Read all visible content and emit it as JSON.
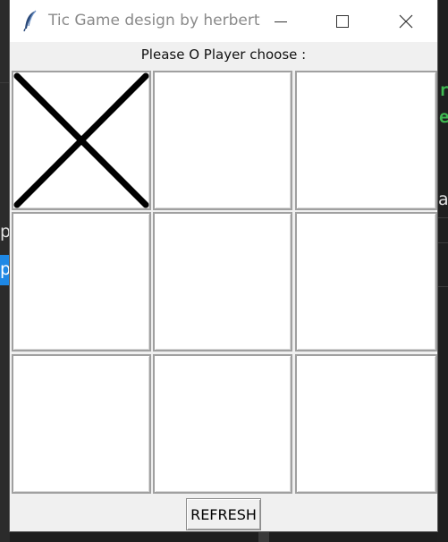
{
  "window": {
    "title": "Tic Game design by herbert",
    "icon": "feather-icon",
    "controls": [
      "minimize-icon",
      "maximize-icon",
      "close-icon"
    ]
  },
  "status_text": "Please O Player choose :",
  "board": {
    "cells": [
      "X",
      "",
      "",
      "",
      "",
      "",
      "",
      "",
      ""
    ]
  },
  "refresh_label": "REFRESH",
  "background": {
    "fragment_letters": [
      "r",
      "e",
      "a",
      "py",
      "p"
    ],
    "colors": {
      "green": "#3fb950",
      "accent_blue": "#1e88e5"
    }
  }
}
